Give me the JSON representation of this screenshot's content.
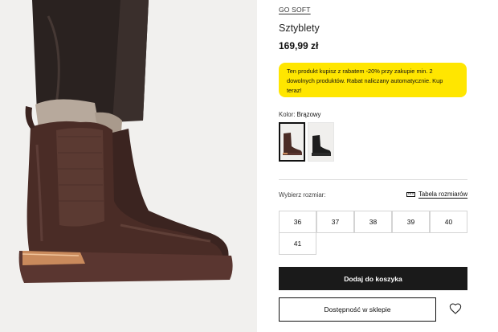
{
  "product": {
    "brand": "GO SOFT",
    "name": "Sztyblety",
    "price": "169,99 zł",
    "image_icon": "product-photo-boots"
  },
  "promo": {
    "text": "Ten produkt kupisz z rabatem -20% przy zakupie min. 2 dowolnych produktów. Rabat naliczany automatycznie. Kup teraz!",
    "background": "#ffe600"
  },
  "color": {
    "label": "Kolor:",
    "selected": "Brązowy",
    "swatches": [
      "brown-boot",
      "black-boot"
    ]
  },
  "sizes": {
    "label": "Wybierz rozmiar:",
    "table_link": "Tabela rozmiarów",
    "options": [
      "36",
      "37",
      "38",
      "39",
      "40",
      "41"
    ]
  },
  "actions": {
    "add_to_cart": "Dodaj do koszyka",
    "availability": "Dostępność w sklepie",
    "wishlist_icon": "heart-icon"
  }
}
